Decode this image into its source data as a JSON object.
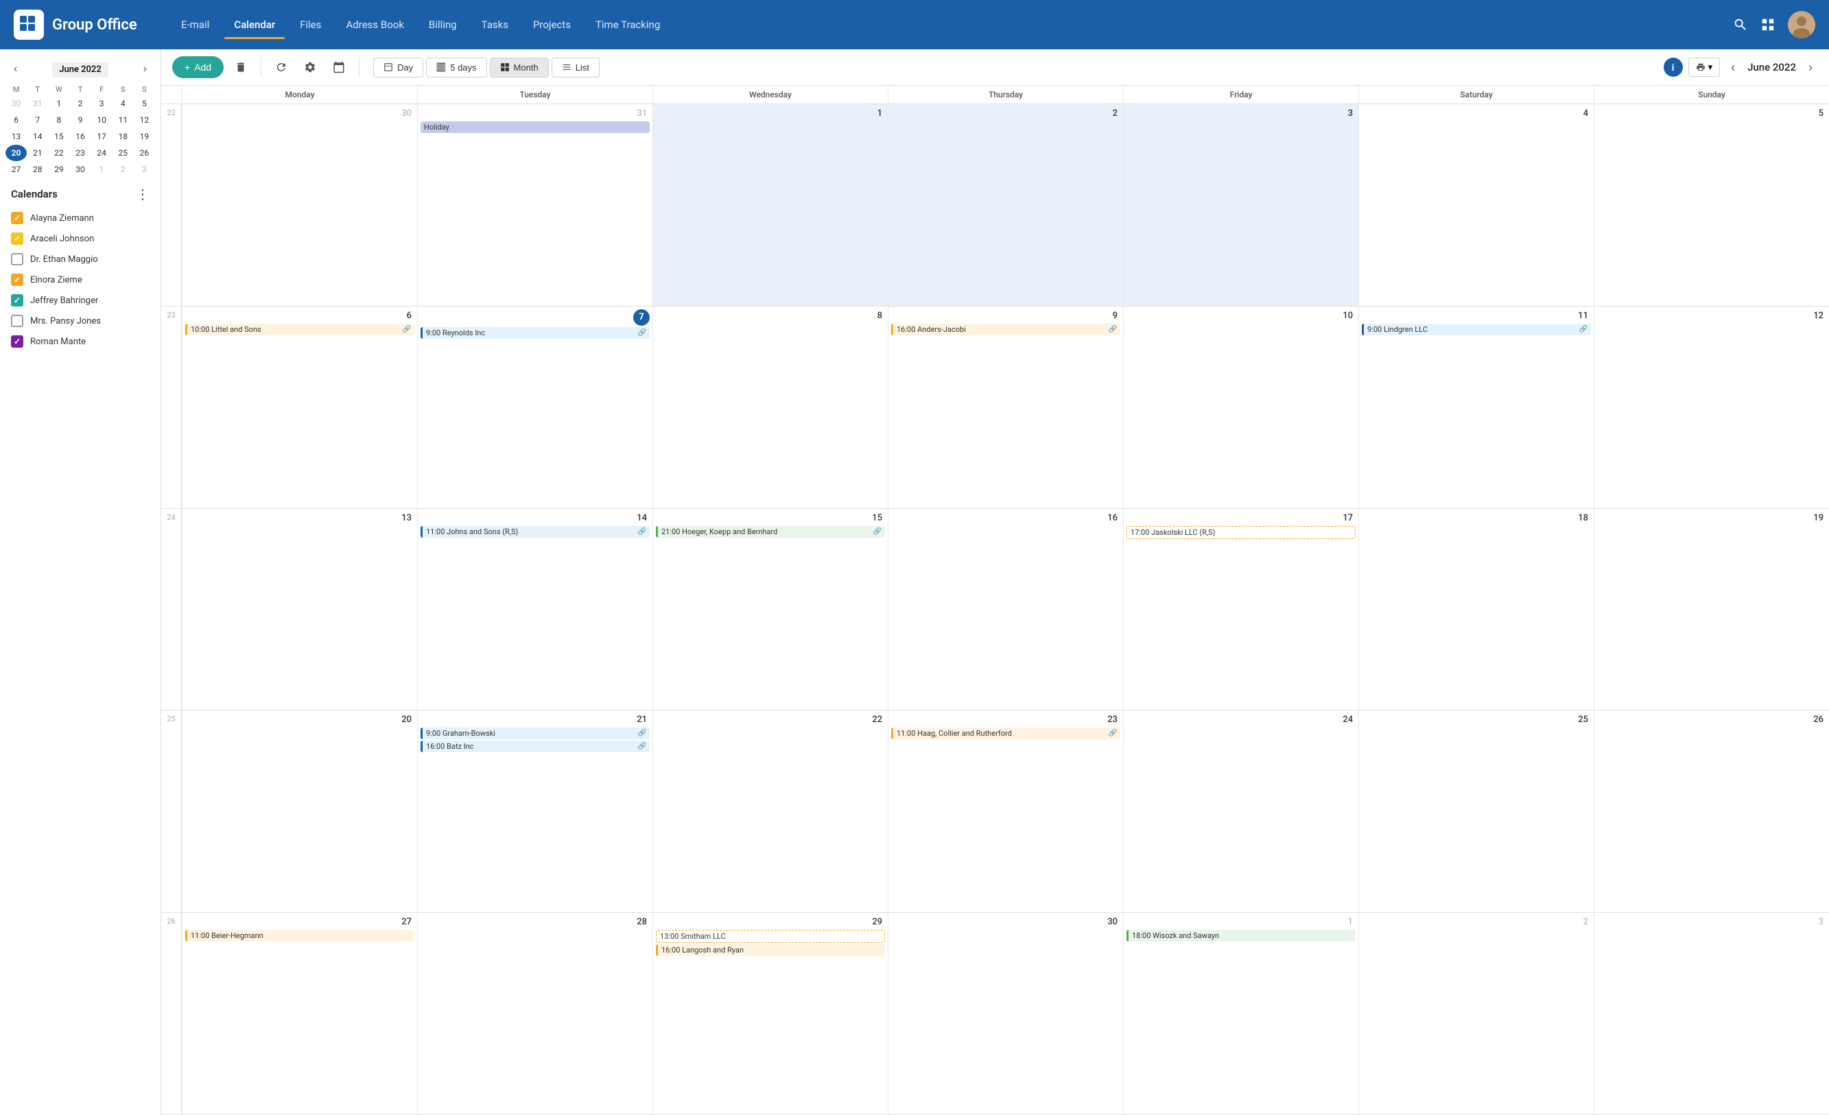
{
  "app": {
    "title": "Group Office",
    "logo_alt": "Group Office Logo"
  },
  "nav": {
    "links": [
      {
        "label": "E-mail",
        "active": false
      },
      {
        "label": "Calendar",
        "active": true
      },
      {
        "label": "Files",
        "active": false
      },
      {
        "label": "Adress Book",
        "active": false
      },
      {
        "label": "Billing",
        "active": false
      },
      {
        "label": "Tasks",
        "active": false
      },
      {
        "label": "Projects",
        "active": false
      },
      {
        "label": "Time Tracking",
        "active": false
      }
    ]
  },
  "toolbar": {
    "add_label": "+ Add",
    "views": [
      "Day",
      "5 days",
      "Month",
      "List"
    ],
    "active_view": "Month",
    "current_month": "June 2022"
  },
  "mini_calendar": {
    "title": "June 2022",
    "weekdays": [
      "M",
      "T",
      "W",
      "T",
      "F",
      "S",
      "S"
    ],
    "weeks": [
      [
        {
          "day": 30,
          "other": true
        },
        {
          "day": 31,
          "other": true
        },
        {
          "day": 1
        },
        {
          "day": 2
        },
        {
          "day": 3
        },
        {
          "day": 4
        },
        {
          "day": 5
        }
      ],
      [
        {
          "day": 6
        },
        {
          "day": 7
        },
        {
          "day": 8
        },
        {
          "day": 9
        },
        {
          "day": 10
        },
        {
          "day": 11
        },
        {
          "day": 12
        }
      ],
      [
        {
          "day": 13
        },
        {
          "day": 14
        },
        {
          "day": 15
        },
        {
          "day": 16
        },
        {
          "day": 17
        },
        {
          "day": 18
        },
        {
          "day": 19
        }
      ],
      [
        {
          "day": 20,
          "today": true
        },
        {
          "day": 21
        },
        {
          "day": 22
        },
        {
          "day": 23
        },
        {
          "day": 24
        },
        {
          "day": 25
        },
        {
          "day": 26
        }
      ],
      [
        {
          "day": 27
        },
        {
          "day": 28
        },
        {
          "day": 29
        },
        {
          "day": 30
        },
        {
          "day": 1,
          "other": true
        },
        {
          "day": 2,
          "other": true
        },
        {
          "day": 3,
          "other": true
        }
      ]
    ]
  },
  "calendars": {
    "title": "Calendars",
    "items": [
      {
        "label": "Alayna Ziemann",
        "checked": true,
        "color": "#f5a623"
      },
      {
        "label": "Araceli Johnson",
        "checked": true,
        "color": "#f5c518"
      },
      {
        "label": "Dr. Ethan Maggio",
        "checked": false,
        "color": "#9e9e9e"
      },
      {
        "label": "Elnora Zieme",
        "checked": true,
        "color": "#f5a623"
      },
      {
        "label": "Jeffrey Bahringer",
        "checked": true,
        "color": "#26a69a"
      },
      {
        "label": "Mrs. Pansy Jones",
        "checked": false,
        "color": "#9e9e9e"
      },
      {
        "label": "Roman Mante",
        "checked": true,
        "color": "#7b1fa2"
      }
    ]
  },
  "calendar_grid": {
    "day_headers": [
      "Monday",
      "Tuesday",
      "Wednesday",
      "Thursday",
      "Friday",
      "Saturday",
      "Sunday"
    ],
    "weeks": [
      {
        "week_num": 22,
        "days": [
          {
            "num": 30,
            "other": true
          },
          {
            "num": 31,
            "other": true,
            "events": [
              {
                "text": "Holiday",
                "type": "holiday"
              }
            ]
          },
          {
            "num": 1,
            "highlight": true
          },
          {
            "num": 2,
            "highlight": true
          },
          {
            "num": 3,
            "highlight": true
          },
          {
            "num": 4
          },
          {
            "num": 5
          }
        ]
      },
      {
        "week_num": 23,
        "days": [
          {
            "num": 6,
            "events": [
              {
                "text": "10:00 Littel and Sons",
                "type": "orange",
                "link": true
              }
            ]
          },
          {
            "num": 7,
            "today_badge": true,
            "events": [
              {
                "text": "9:00 Reynolds Inc",
                "type": "blue",
                "link": true
              }
            ]
          },
          {
            "num": 8
          },
          {
            "num": 9,
            "events": [
              {
                "text": "16:00 Anders-Jacobi",
                "type": "orange",
                "link": true
              }
            ]
          },
          {
            "num": 10
          },
          {
            "num": 11,
            "events": [
              {
                "text": "9:00 Lindgren LLC",
                "type": "blue",
                "link": true
              }
            ]
          },
          {
            "num": 12
          }
        ]
      },
      {
        "week_num": 24,
        "days": [
          {
            "num": 13
          },
          {
            "num": 14,
            "events": [
              {
                "text": "11:00 Johns and Sons (R,S)",
                "type": "blue",
                "link": true
              }
            ]
          },
          {
            "num": 15,
            "events": [
              {
                "text": "21:00 Hoeger, Koepp and Bernhard",
                "type": "green",
                "link": true
              }
            ]
          },
          {
            "num": 16
          },
          {
            "num": 17,
            "events": [
              {
                "text": "17:00 Jaskolski LLC (R,S)",
                "type": "yellow-outline"
              }
            ]
          },
          {
            "num": 18
          },
          {
            "num": 19
          }
        ]
      },
      {
        "week_num": 25,
        "days": [
          {
            "num": 20
          },
          {
            "num": 21,
            "events": [
              {
                "text": "9:00 Graham-Bowski",
                "type": "blue",
                "link": true
              },
              {
                "text": "16:00 Batz Inc",
                "type": "blue",
                "link": true
              }
            ]
          },
          {
            "num": 22
          },
          {
            "num": 23,
            "events": [
              {
                "text": "11:00 Haag, Collier and Rutherford",
                "type": "orange",
                "link": true
              }
            ]
          },
          {
            "num": 24
          },
          {
            "num": 25
          },
          {
            "num": 26
          }
        ]
      },
      {
        "week_num": 26,
        "days": [
          {
            "num": 27,
            "events": [
              {
                "text": "11:00 Beier-Hegmann",
                "type": "orange"
              }
            ]
          },
          {
            "num": 28
          },
          {
            "num": 29,
            "events": [
              {
                "text": "13:00 Smitham LLC",
                "type": "yellow-outline"
              },
              {
                "text": "16:00 Langosh and Ryan",
                "type": "orange"
              }
            ]
          },
          {
            "num": 30
          },
          {
            "num": 1,
            "other": true,
            "events": [
              {
                "text": "18:00 Wisozk and Sawayn",
                "type": "green"
              }
            ]
          },
          {
            "num": 2,
            "other": true
          },
          {
            "num": 3,
            "other": true
          }
        ]
      }
    ]
  }
}
